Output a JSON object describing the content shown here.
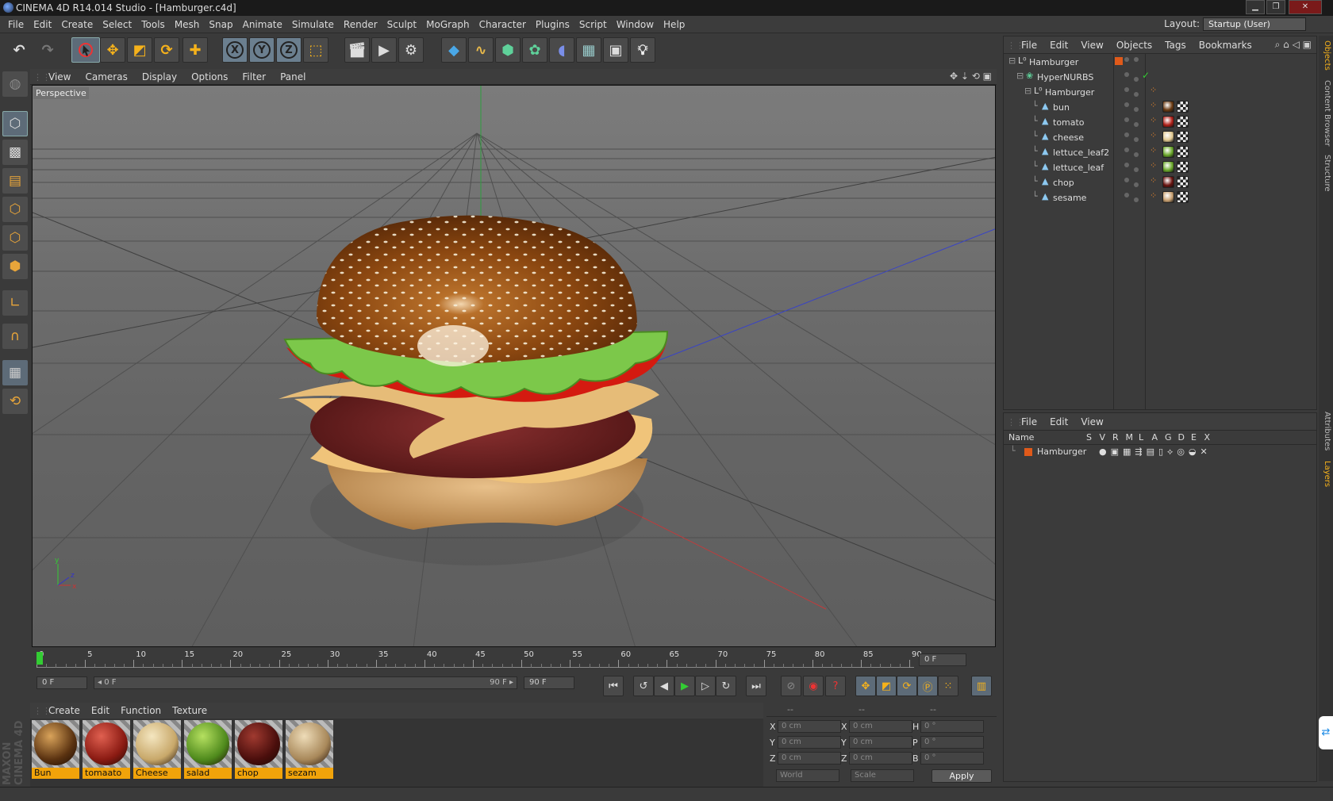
{
  "window": {
    "title": "CINEMA 4D R14.014 Studio - [Hamburger.c4d]"
  },
  "menubar": {
    "items": [
      "File",
      "Edit",
      "Create",
      "Select",
      "Tools",
      "Mesh",
      "Snap",
      "Animate",
      "Simulate",
      "Render",
      "Sculpt",
      "MoGraph",
      "Character",
      "Plugins",
      "Script",
      "Window",
      "Help"
    ],
    "layout_label": "Layout:",
    "layout_value": "Startup (User)"
  },
  "toolbar": {
    "undo": "↶",
    "redo": "↷",
    "x": "X",
    "y": "Y",
    "z": "Z"
  },
  "viewport": {
    "menu": [
      "View",
      "Cameras",
      "Display",
      "Options",
      "Filter",
      "Panel"
    ],
    "label": "Perspective",
    "axis": {
      "y": "y",
      "x": "x",
      "z": "z"
    }
  },
  "timeline": {
    "ticks": [
      "0",
      "5",
      "10",
      "15",
      "20",
      "25",
      "30",
      "35",
      "40",
      "45",
      "50",
      "55",
      "60",
      "65",
      "70",
      "75",
      "80",
      "85",
      "90"
    ],
    "current_frame": "0 F"
  },
  "transport": {
    "start": "0 F",
    "slider_left": "◂ 0 F",
    "slider_right": "90 F ▸",
    "end": "90 F"
  },
  "material_menu": [
    "Create",
    "Edit",
    "Function",
    "Texture"
  ],
  "materials": [
    {
      "name": "Bun",
      "color": "#5a3210",
      "hi": "#d9a35a"
    },
    {
      "name": "tomaato",
      "color": "#8a1a12",
      "hi": "#e06050"
    },
    {
      "name": "Cheese",
      "color": "#c8a86a",
      "hi": "#f4e6c0"
    },
    {
      "name": "salad",
      "color": "#4f8a1c",
      "hi": "#b5e060"
    },
    {
      "name": "chop",
      "color": "#4a0e0c",
      "hi": "#a03a30"
    },
    {
      "name": "sezam",
      "color": "#a8885a",
      "hi": "#eedcb8"
    }
  ],
  "coords": {
    "headers": [
      "--",
      "--",
      "--"
    ],
    "rows": [
      {
        "l1": "X",
        "v1": "0 cm",
        "l2": "X",
        "v2": "0 cm",
        "l3": "H",
        "v3": "0 °"
      },
      {
        "l1": "Y",
        "v1": "0 cm",
        "l2": "Y",
        "v2": "0 cm",
        "l3": "P",
        "v3": "0 °"
      },
      {
        "l1": "Z",
        "v1": "0 cm",
        "l2": "Z",
        "v2": "0 cm",
        "l3": "B",
        "v3": "0 °"
      }
    ],
    "world": "World",
    "scale": "Scale",
    "apply": "Apply"
  },
  "objects": {
    "menu": [
      "File",
      "Edit",
      "View",
      "Objects",
      "Tags",
      "Bookmarks"
    ],
    "items": [
      {
        "name": "Hamburger",
        "depth": 0
      },
      {
        "name": "HyperNURBS",
        "depth": 1
      },
      {
        "name": "Hamburger",
        "depth": 2
      },
      {
        "name": "bun",
        "depth": 3,
        "mat": "#6a3a12"
      },
      {
        "name": "tomato",
        "depth": 3,
        "mat": "#b02018"
      },
      {
        "name": "cheese",
        "depth": 3,
        "mat": "#e0c890"
      },
      {
        "name": "lettuce_leaf2",
        "depth": 3,
        "mat": "#6aa82a"
      },
      {
        "name": "lettuce_leaf",
        "depth": 3,
        "mat": "#6aa82a"
      },
      {
        "name": "chop",
        "depth": 3,
        "mat": "#6a1410"
      },
      {
        "name": "sesame",
        "depth": 3,
        "mat": "#c8a070"
      }
    ]
  },
  "layers": {
    "menu": [
      "File",
      "Edit",
      "View"
    ],
    "columns": [
      "Name",
      "S",
      "V",
      "R",
      "M",
      "L",
      "A",
      "G",
      "D",
      "E",
      "X"
    ],
    "rows": [
      {
        "name": "Hamburger"
      }
    ]
  },
  "side_tabs": [
    "Objects",
    "Content Browser",
    "Structure",
    "Attributes",
    "Layers"
  ],
  "branding": "MAXON CINEMA 4D"
}
